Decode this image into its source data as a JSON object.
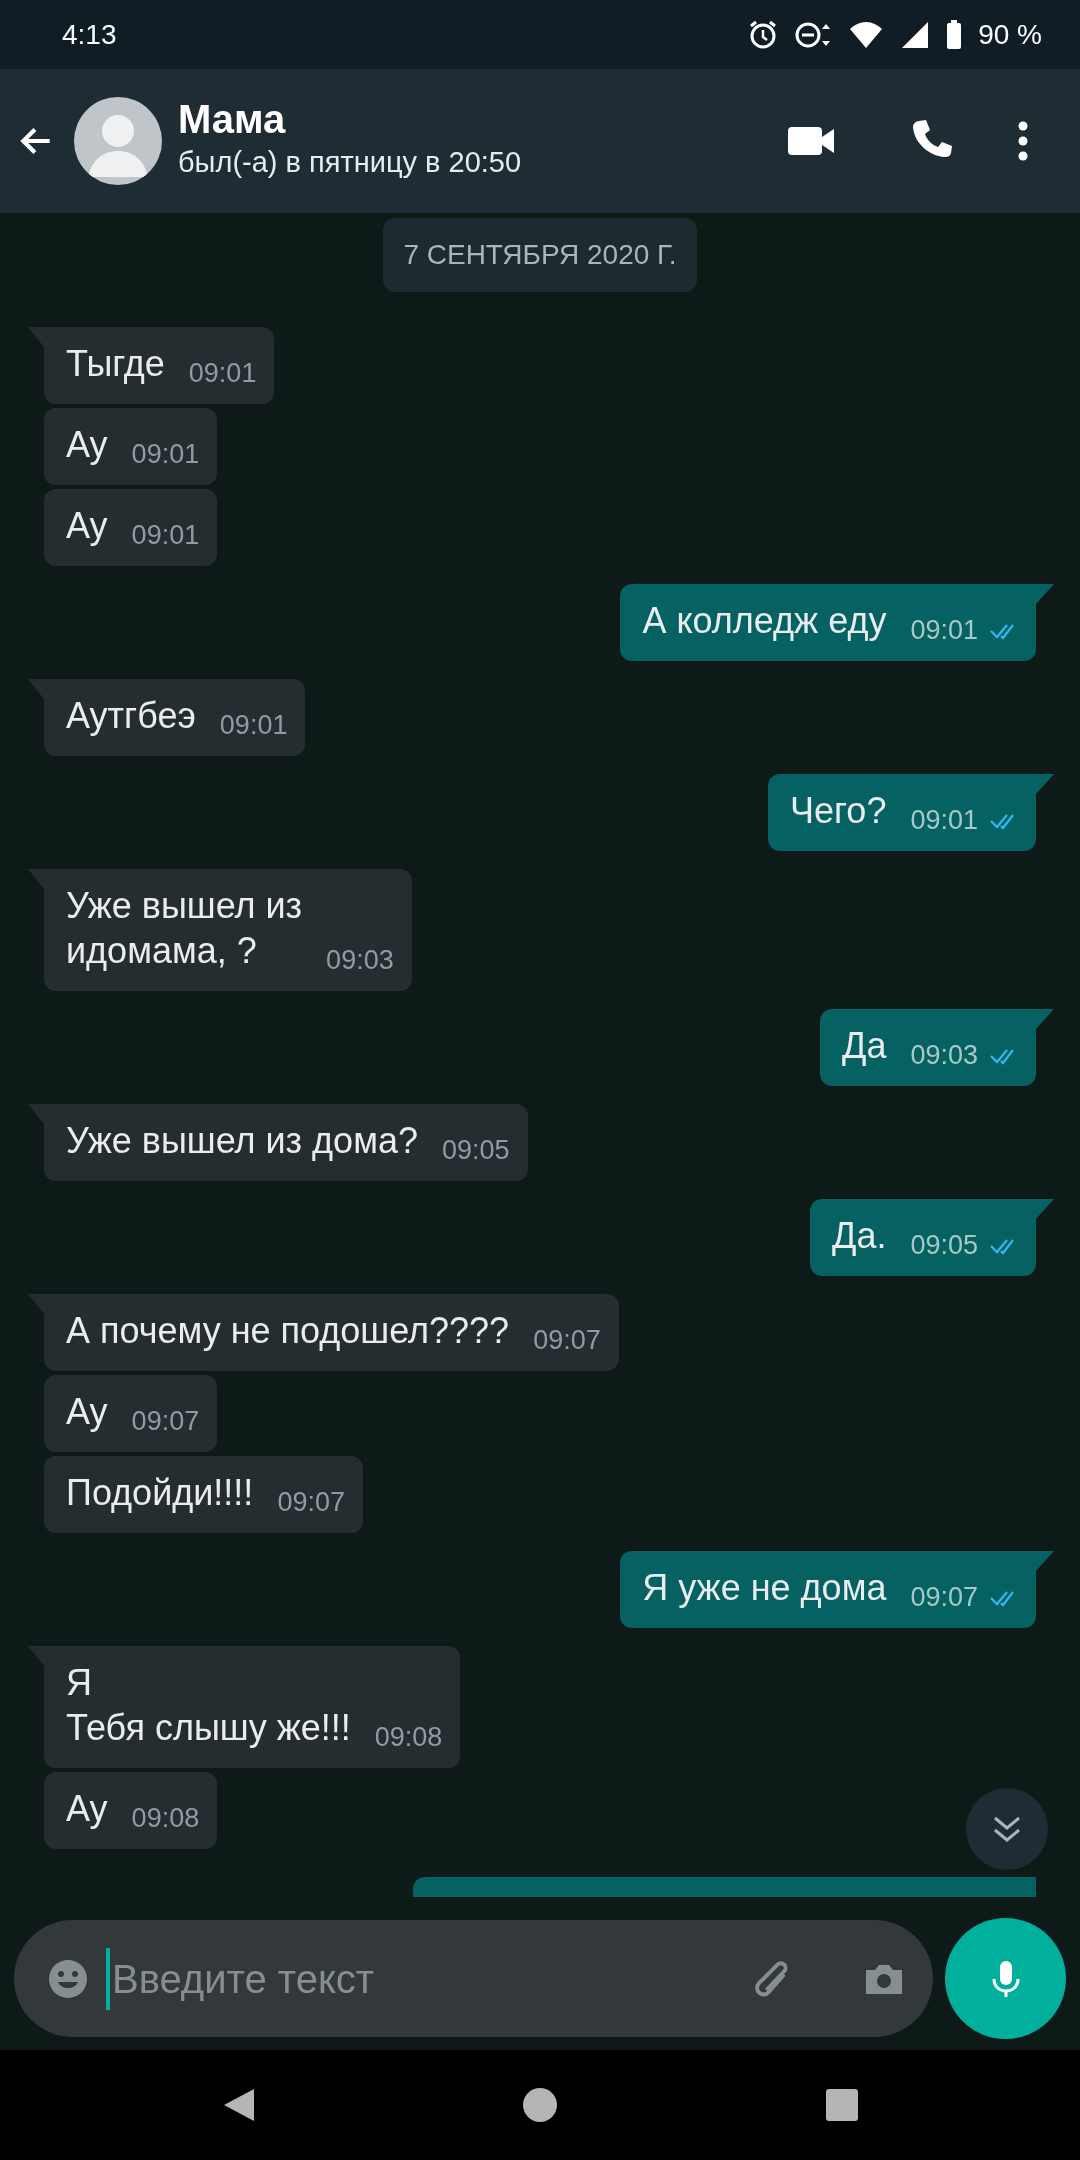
{
  "status_bar": {
    "time": "4:13",
    "battery": "90 %"
  },
  "contact": {
    "name": "Мама",
    "last_seen": "был(-а) в пятницу в 20:50"
  },
  "date_chip": "7 СЕНТЯБРЯ 2020 Г.",
  "messages": [
    {
      "kind": "incoming",
      "text": "Тыгде",
      "time": "09:01"
    },
    {
      "kind": "incoming",
      "text": "Ау",
      "time": "09:01"
    },
    {
      "kind": "incoming",
      "text": "Ау",
      "time": "09:01"
    },
    {
      "kind": "outgoing",
      "text": "А колледж еду",
      "time": "09:01",
      "read": true
    },
    {
      "kind": "incoming",
      "text": "Аутгбеэ",
      "time": "09:01"
    },
    {
      "kind": "outgoing",
      "text": "Чего?",
      "time": "09:01",
      "read": true
    },
    {
      "kind": "incoming",
      "text": "Уже вышел из\nидомама, ?",
      "time": "09:03"
    },
    {
      "kind": "outgoing",
      "text": "Да",
      "time": "09:03",
      "read": true
    },
    {
      "kind": "incoming",
      "text": "Уже вышел из дома?",
      "time": "09:05"
    },
    {
      "kind": "outgoing",
      "text": "Да.",
      "time": "09:05",
      "read": true
    },
    {
      "kind": "incoming",
      "text": "А почему не подошел????",
      "time": "09:07"
    },
    {
      "kind": "incoming",
      "text": "Ау",
      "time": "09:07"
    },
    {
      "kind": "incoming",
      "text": "Подойди!!!!",
      "time": "09:07"
    },
    {
      "kind": "outgoing",
      "text": "Я уже не дома",
      "time": "09:07",
      "read": true
    },
    {
      "kind": "incoming",
      "text": "Я\nТебя слышу же!!!",
      "time": "09:08"
    },
    {
      "kind": "incoming",
      "text": "Ау",
      "time": "09:08"
    }
  ],
  "composer": {
    "placeholder": "Введите текст"
  }
}
